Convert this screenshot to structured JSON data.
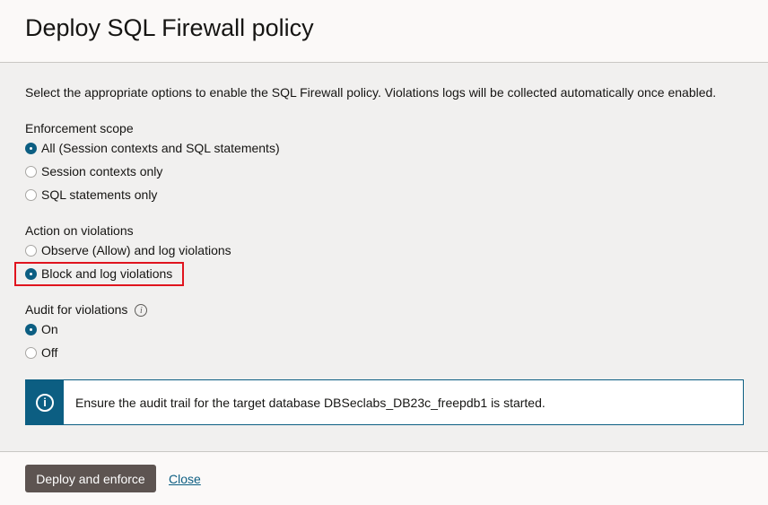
{
  "dialog": {
    "title": "Deploy SQL Firewall policy",
    "intro": "Select the appropriate options to enable the SQL Firewall policy. Violations logs will be collected automatically once enabled."
  },
  "enforcement_scope": {
    "label": "Enforcement scope",
    "options": [
      {
        "label": "All (Session contexts and SQL statements)",
        "selected": true
      },
      {
        "label": "Session contexts only",
        "selected": false
      },
      {
        "label": "SQL statements only",
        "selected": false
      }
    ]
  },
  "action_on_violations": {
    "label": "Action on violations",
    "options": [
      {
        "label": "Observe (Allow) and log violations",
        "selected": false
      },
      {
        "label": "Block and log violations",
        "selected": true
      }
    ]
  },
  "audit_for_violations": {
    "label": "Audit for violations",
    "info_icon": "info-icon",
    "options": [
      {
        "label": "On",
        "selected": true
      },
      {
        "label": "Off",
        "selected": false
      }
    ]
  },
  "info_banner": {
    "icon": "info-icon",
    "text": "Ensure the audit trail for the target database DBSeclabs_DB23c_freepdb1 is started."
  },
  "footer": {
    "deploy_label": "Deploy and enforce",
    "close_label": "Close"
  },
  "colors": {
    "accent": "#0c5e82",
    "primary_button": "#5d5451",
    "highlight": "#e0141e",
    "panel_background": "#f1f0ef"
  }
}
